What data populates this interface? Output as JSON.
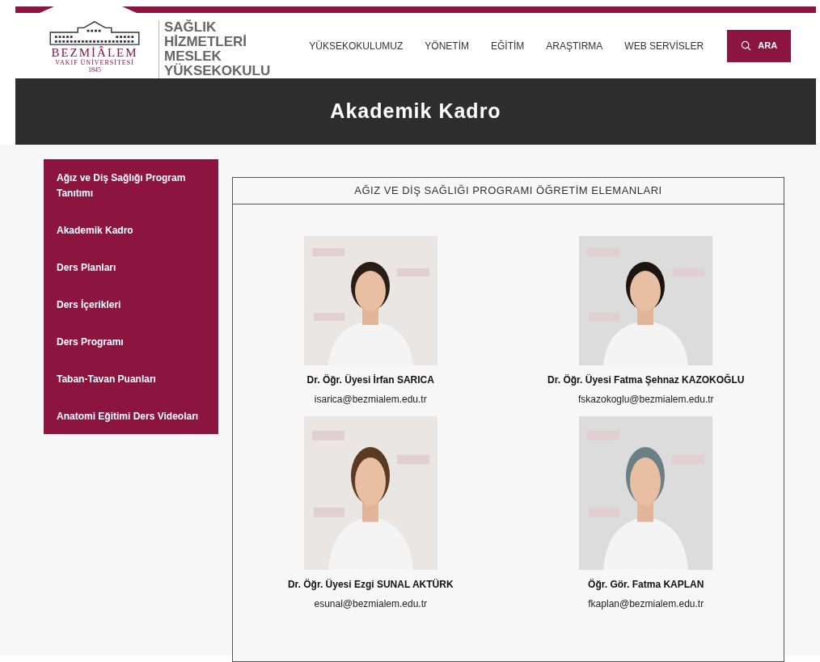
{
  "logo": {
    "name": "BEZMİÂLEM",
    "subtitle": "VAKIF ÜNİVERSİTESİ",
    "year": "1845"
  },
  "school": {
    "lines": [
      "SAĞLIK",
      "HİZMETLERİ",
      "MESLEK",
      "YÜKSEKOKULU"
    ]
  },
  "nav": [
    "YÜKSEKOKULUMUZ",
    "YÖNETİM",
    "EĞİTİM",
    "ARAŞTIRMA",
    "WEB SERVİSLER"
  ],
  "search_button": "ARA",
  "page_title": "Akademik Kadro",
  "sidebar": {
    "items": [
      {
        "label": "Ağız ve Diş Sağlığı Program Tanıtımı"
      },
      {
        "label": "Akademik Kadro"
      },
      {
        "label": "Ders Planları"
      },
      {
        "label": "Ders İçerikleri"
      },
      {
        "label": "Ders Programı"
      },
      {
        "label": "Taban-Tavan Puanları"
      },
      {
        "label": "Anatomi Eğitimi Ders Videoları"
      }
    ]
  },
  "staff_panel": {
    "heading": "AĞIZ VE DİŞ SAĞLIĞI PROGRAMI ÖĞRETİM ELEMANLARI",
    "members": [
      {
        "name": "Dr. Öğr. Üyesi İrfan SARICA",
        "email": "isarica@bezmialem.edu.tr"
      },
      {
        "name": "Dr. Öğr. Üyesi Fatma Şehnaz KAZOKOĞLU",
        "email": "fskazokoglu@bezmialem.edu.tr"
      },
      {
        "name": "Dr. Öğr. Üyesi Ezgi SUNAL AKTÜRK",
        "email": "esunal@bezmialem.edu.tr"
      },
      {
        "name": "Öğr. Gör. Fatma KAPLAN",
        "email": "fkaplan@bezmialem.edu.tr"
      }
    ]
  }
}
